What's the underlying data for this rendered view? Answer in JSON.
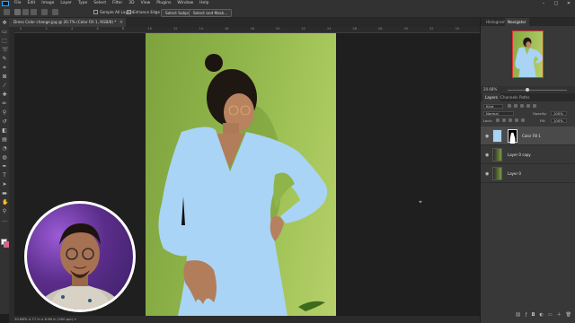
{
  "app": {
    "logo_text": "Ps"
  },
  "menu": [
    "File",
    "Edit",
    "Image",
    "Layer",
    "Type",
    "Select",
    "Filter",
    "3D",
    "View",
    "Plugins",
    "Window",
    "Help"
  ],
  "window_controls": [
    "–",
    "□",
    "✕"
  ],
  "options_bar": {
    "sample_all_layers": "Sample All Layers",
    "enhance_edge": "Enhance Edge",
    "select_subject": "Select Subject",
    "select_and_mask": "Select and Mask..."
  },
  "document_tab": {
    "title": "Dress Color change.jpg @ 20.7% (Color Fill 1, RGB/8) *",
    "close": "×"
  },
  "ruler_ticks": [
    "0",
    "2",
    "4",
    "6",
    "8",
    "10",
    "12",
    "14",
    "16",
    "18",
    "20",
    "22",
    "24",
    "26",
    "28",
    "30",
    "32",
    "34"
  ],
  "status_bar": "20.68%   4.77 in x 6.98 in (300 ppi)   >",
  "panels": {
    "top_tabs": [
      "Histogram",
      "Navigator"
    ],
    "navigator_zoom": "20.68%",
    "layers_tabs": [
      "Layers",
      "Channels",
      "Paths"
    ],
    "filter_kind": "Kind",
    "blend_mode": "Normal",
    "opacity_label": "Opacity:",
    "opacity_value": "100%",
    "lock_label": "Lock:",
    "fill_label": "Fill:",
    "fill_value": "100%",
    "layers": [
      {
        "name": "Color Fill 1",
        "selected": true
      },
      {
        "name": "Layer 0 copy",
        "selected": false
      },
      {
        "name": "Layer 0",
        "selected": false
      }
    ]
  },
  "colors": {
    "fill_color": "#a9d4f5",
    "fg_swatch": "#ffffff",
    "bg_swatch": "#e85c93",
    "canvas_wall": "#8fb44a"
  }
}
